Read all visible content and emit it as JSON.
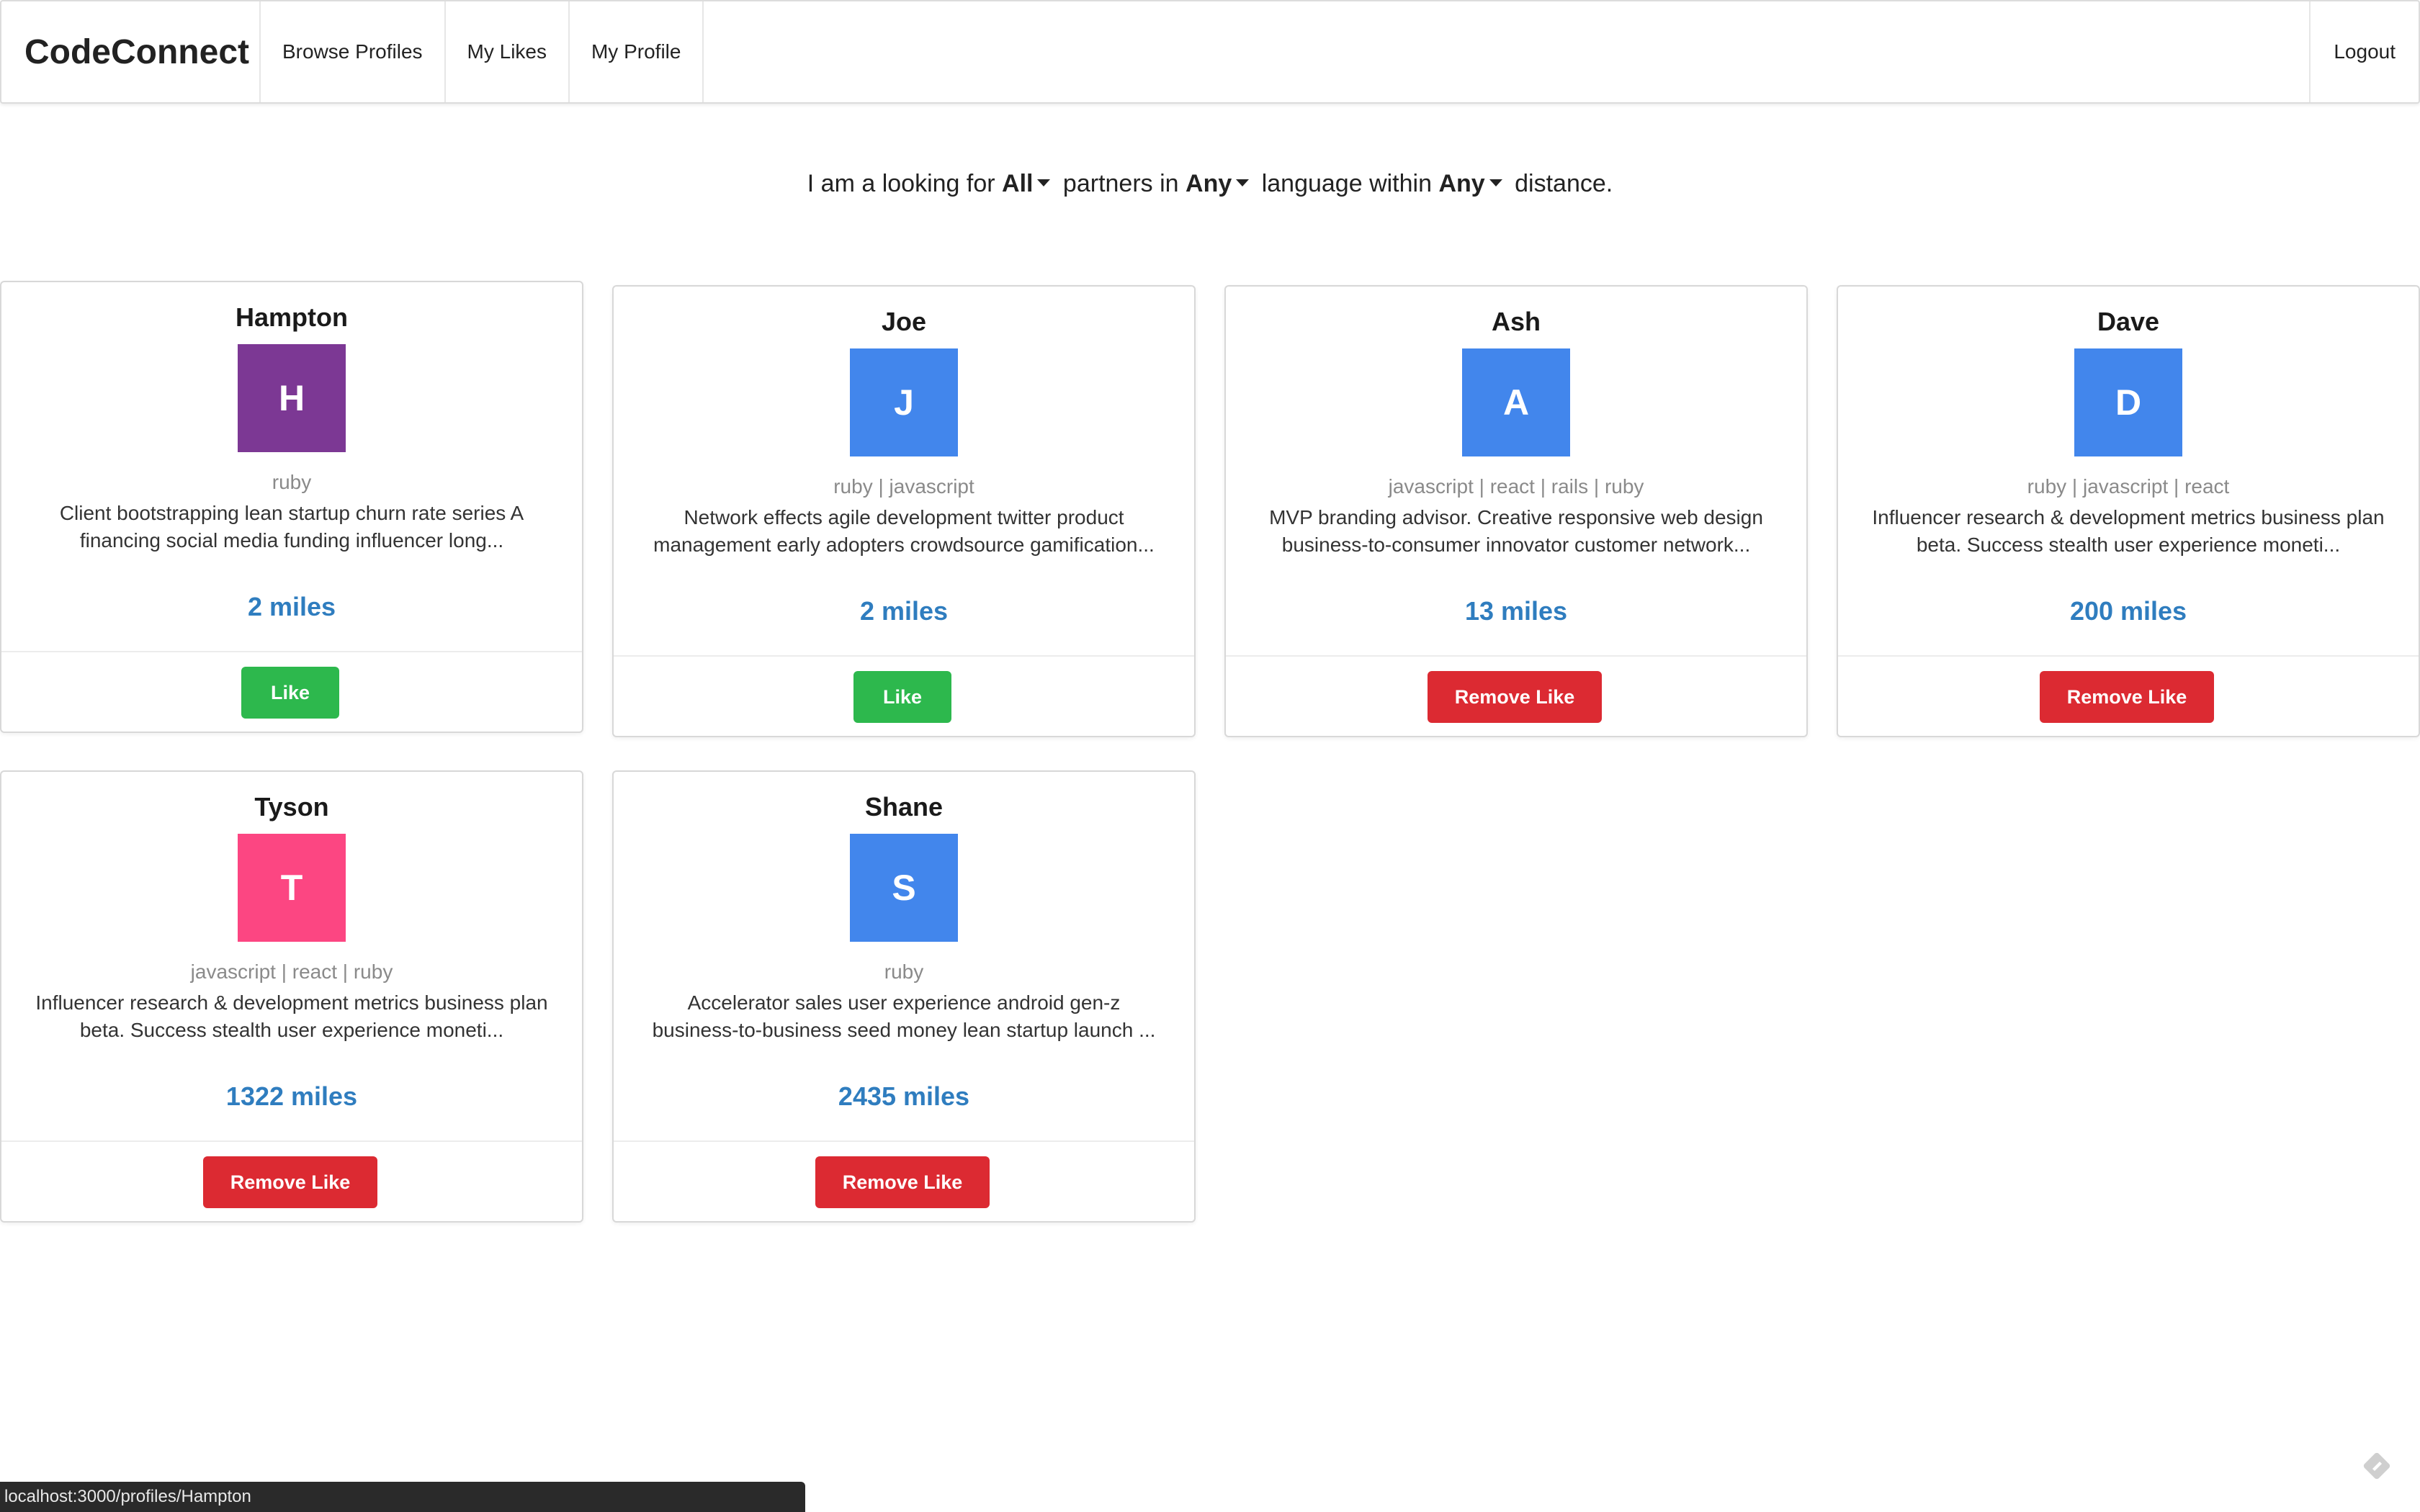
{
  "nav": {
    "brand": "CodeConnect",
    "items": [
      "Browse Profiles",
      "My Likes",
      "My Profile"
    ],
    "logout": "Logout"
  },
  "filter": {
    "prefix": "I am a looking for",
    "looking_for": "All",
    "middle1": "partners in",
    "language": "Any",
    "middle2": "language within",
    "distance": "Any",
    "suffix": "distance."
  },
  "profiles": [
    {
      "name": "Hampton",
      "initial": "H",
      "color": "#7c3894",
      "languages": "ruby",
      "bio_line1": "Client bootstrapping lean startup churn rate series A",
      "bio_line2": "financing social media funding influencer long...",
      "distance": "2 miles",
      "action": "Like"
    },
    {
      "name": "Joe",
      "initial": "J",
      "color": "#4286ec",
      "languages": "ruby | javascript",
      "bio_line1": "Network effects agile development twitter product",
      "bio_line2": "management early adopters crowdsource gamification...",
      "distance": "2 miles",
      "action": "Like"
    },
    {
      "name": "Ash",
      "initial": "A",
      "color": "#4286ec",
      "languages": "javascript | react | rails | ruby",
      "bio_line1": "MVP branding advisor. Creative responsive web design",
      "bio_line2": "business-to-consumer innovator customer network...",
      "distance": "13 miles",
      "action": "Remove Like"
    },
    {
      "name": "Dave",
      "initial": "D",
      "color": "#4286ec",
      "languages": "ruby | javascript | react",
      "bio_line1": "Influencer research & development metrics business plan",
      "bio_line2": "beta. Success stealth user experience moneti...",
      "distance": "200 miles",
      "action": "Remove Like"
    },
    {
      "name": "Tyson",
      "initial": "T",
      "color": "#fc4682",
      "languages": "javascript | react | ruby",
      "bio_line1": "Influencer research & development metrics business plan",
      "bio_line2": "beta. Success stealth user experience moneti...",
      "distance": "1322 miles",
      "action": "Remove Like"
    },
    {
      "name": "Shane",
      "initial": "S",
      "color": "#4286ec",
      "languages": "ruby",
      "bio_line1": "Accelerator sales user experience android gen-z",
      "bio_line2": "business-to-business seed money lean startup launch ...",
      "distance": "2435 miles",
      "action": "Remove Like"
    }
  ],
  "status_url": "localhost:3000/profiles/Hampton"
}
